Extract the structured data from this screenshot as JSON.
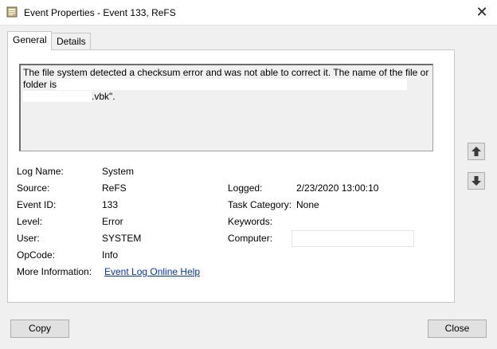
{
  "window": {
    "title": "Event Properties - Event 133, ReFS",
    "icon": "event-log-icon",
    "close_glyph": "✕"
  },
  "tabs": [
    {
      "label": "General",
      "selected": true
    },
    {
      "label": "Details",
      "selected": false
    }
  ],
  "message": {
    "line1": "The file system detected a checksum error and was not able to correct it. The name of the file or",
    "line2": "folder is",
    "line3_suffix": ".vbk\"."
  },
  "fields": {
    "log_name": {
      "label": "Log Name:",
      "value": "System"
    },
    "source": {
      "label": "Source:",
      "value": "ReFS"
    },
    "event_id": {
      "label": "Event ID:",
      "value": "133"
    },
    "level": {
      "label": "Level:",
      "value": "Error"
    },
    "user": {
      "label": "User:",
      "value": "SYSTEM"
    },
    "opcode": {
      "label": "OpCode:",
      "value": "Info"
    },
    "more_info": {
      "label": "More Information:",
      "link": "Event Log Online Help"
    },
    "logged": {
      "label": "Logged:",
      "value": "2/23/2020 13:00:10"
    },
    "task_category": {
      "label": "Task Category:",
      "value": "None"
    },
    "keywords": {
      "label": "Keywords:",
      "value": ""
    },
    "computer": {
      "label": "Computer:",
      "value": ""
    }
  },
  "nav": {
    "up_icon": "arrow-up-icon",
    "down_icon": "arrow-down-icon"
  },
  "buttons": {
    "copy": "Copy",
    "close": "Close"
  }
}
